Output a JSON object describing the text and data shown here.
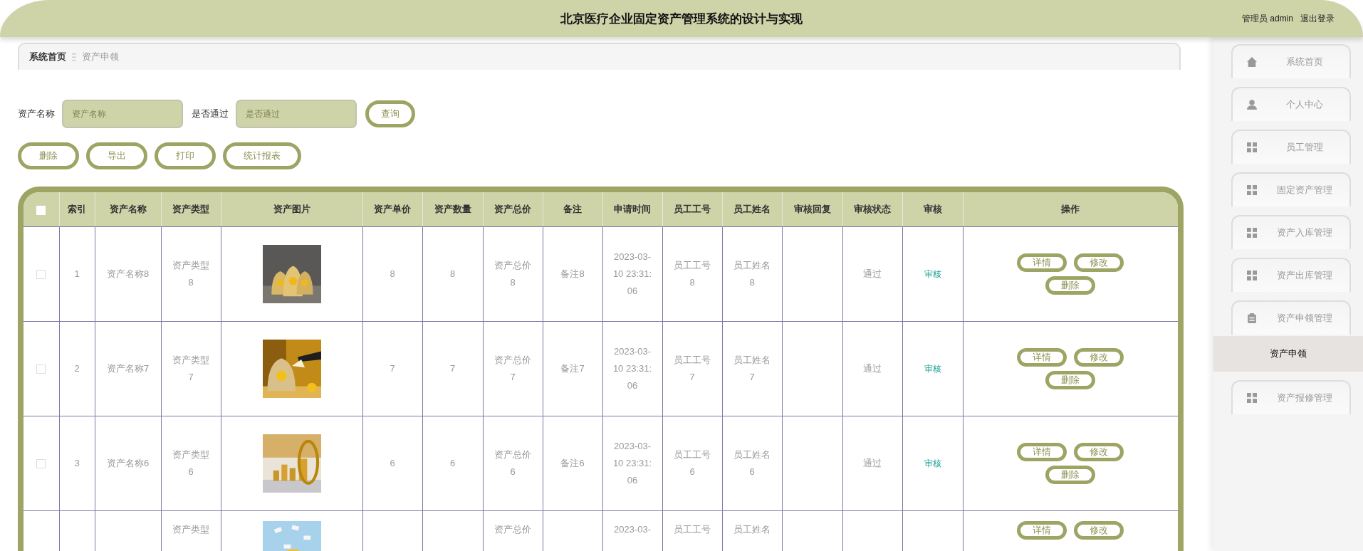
{
  "header": {
    "title": "北京医疗企业固定资产管理系统的设计与实现",
    "user": "管理员 admin",
    "logout": "退出登录"
  },
  "breadcrumb": [
    {
      "label": "系统首页",
      "current": false
    },
    {
      "label": "资产申领",
      "current": true
    }
  ],
  "search": {
    "fields": [
      {
        "label": "资产名称",
        "placeholder": "资产名称"
      },
      {
        "label": "是否通过",
        "placeholder": "是否通过"
      }
    ],
    "button": "查询"
  },
  "actions": [
    "删除",
    "导出",
    "打印",
    "统计报表"
  ],
  "table": {
    "header_checked": false,
    "columns": [
      "索引",
      "资产名称",
      "资产类型",
      "资产图片",
      "资产单价",
      "资产数量",
      "资产总价",
      "备注",
      "申请时间",
      "员工工号",
      "员工姓名",
      "审核回复",
      "审核状态",
      "审核",
      "操作"
    ],
    "rows": [
      {
        "checked": false,
        "cells": [
          "1",
          "资产名称8",
          "资产类型8",
          {
            "kind": "picture"
          },
          "8",
          "8",
          "资产总价8",
          "备注8",
          "2023-03-10 23:31:06",
          "员工工号8",
          "员工姓名8",
          null,
          "通过",
          {
            "kind": "link",
            "text": "审核"
          },
          {
            "kind": "actions",
            "buttons": [
              "详情",
              "修改",
              "删除"
            ]
          }
        ]
      },
      {
        "checked": false,
        "cells": [
          "2",
          "资产名称7",
          "资产类型7",
          {
            "kind": "picture"
          },
          "7",
          "7",
          "资产总价7",
          "备注7",
          "2023-03-10 23:31:06",
          "员工工号7",
          "员工姓名7",
          null,
          "通过",
          {
            "kind": "link",
            "text": "审核"
          },
          {
            "kind": "actions",
            "buttons": [
              "详情",
              "修改",
              "删除"
            ]
          }
        ]
      },
      {
        "checked": false,
        "cells": [
          "3",
          "资产名称6",
          "资产类型6",
          {
            "kind": "picture"
          },
          "6",
          "6",
          "资产总价6",
          "备注6",
          "2023-03-10 23:31:06",
          "员工工号6",
          "员工姓名6",
          null,
          "通过",
          {
            "kind": "link",
            "text": "审核"
          },
          {
            "kind": "actions",
            "buttons": [
              "详情",
              "修改",
              "删除"
            ]
          }
        ]
      },
      {
        "cells": [
          null,
          null,
          "资产类型",
          {
            "kind": "picture"
          },
          null,
          null,
          "资产总价",
          null,
          "2023-03-",
          "员工工号",
          "员工姓名",
          null,
          null,
          null,
          {
            "kind": "actions",
            "buttons": [
              "详情",
              "修改"
            ]
          }
        ]
      }
    ]
  },
  "sidebar": {
    "items": [
      {
        "label": "系统首页",
        "kind": "home"
      },
      {
        "label": "个人中心",
        "kind": "user"
      },
      {
        "label": "员工管理",
        "kind": "grid"
      },
      {
        "label": "固定资产管理",
        "kind": "grid"
      },
      {
        "label": "资产入库管理",
        "kind": "grid"
      },
      {
        "label": "资产出库管理",
        "kind": "grid"
      },
      {
        "label": "资产申领管理",
        "kind": "clipboard",
        "children": [
          {
            "label": "资产申领",
            "selected": true
          }
        ]
      },
      {
        "label": "资产报修管理",
        "kind": "grid"
      }
    ]
  }
}
